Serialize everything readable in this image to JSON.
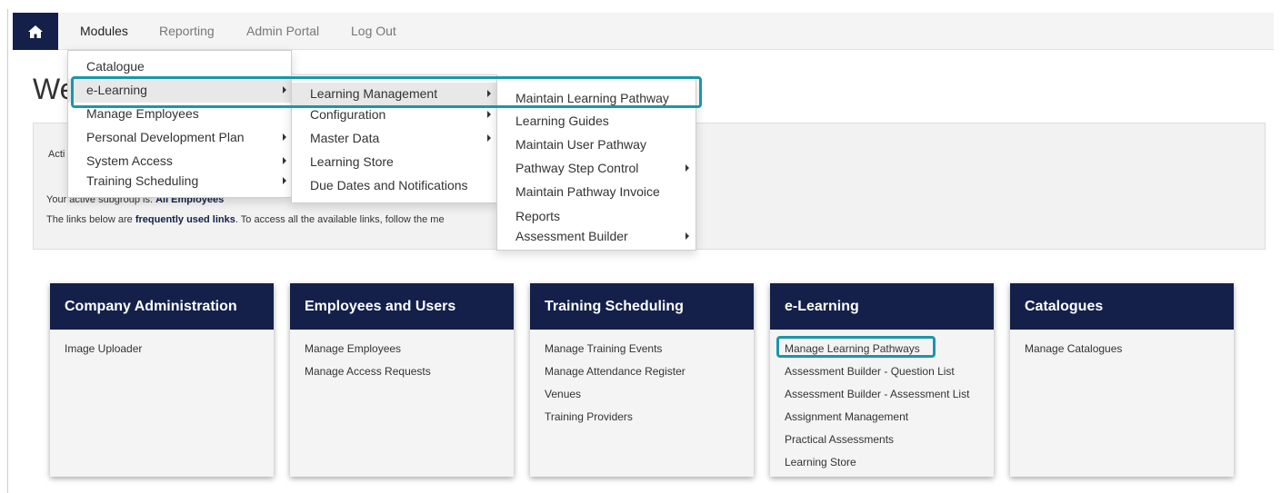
{
  "navbar": {
    "home_icon": "home-icon",
    "items": [
      "Modules",
      "Reporting",
      "Admin Portal",
      "Log Out"
    ]
  },
  "page": {
    "welcome_partial": "We",
    "info_active_partial": "Acti",
    "info_subgroup_prefix": "Your active subgroup is:",
    "info_subgroup_value": "All Employees",
    "info_links_prefix": "The links below are",
    "info_links_bold": "frequently used links",
    "info_links_suffix": ". To access all the available links, follow the me"
  },
  "menus": {
    "modules": [
      "Catalogue",
      "e-Learning",
      "Manage Employees",
      "Personal Development Plan",
      "System Access",
      "Training Scheduling"
    ],
    "elearning": [
      "Learning Management",
      "Configuration",
      "Master Data",
      "Learning Store",
      "Due Dates and Notifications"
    ],
    "learning_management": [
      "Maintain Learning Pathway",
      "Learning Guides",
      "Maintain User Pathway",
      "Pathway Step Control",
      "Maintain Pathway Invoice",
      "Reports",
      "Assessment Builder"
    ]
  },
  "cards": [
    {
      "title": "Company Administration",
      "links": [
        "Image Uploader"
      ]
    },
    {
      "title": "Employees and Users",
      "links": [
        "Manage Employees",
        "Manage Access Requests"
      ]
    },
    {
      "title": "Training Scheduling",
      "links": [
        "Manage Training Events",
        "Manage Attendance Register",
        "Venues",
        "Training Providers"
      ]
    },
    {
      "title": "e-Learning",
      "links": [
        "Manage Learning Pathways",
        "Assessment Builder - Question List",
        "Assessment Builder - Assessment List",
        "Assignment Management",
        "Practical Assessments",
        "Learning Store"
      ]
    },
    {
      "title": "Catalogues",
      "links": [
        "Manage Catalogues"
      ]
    }
  ],
  "colors": {
    "navy": "#14204a",
    "highlight": "#1a97a8"
  }
}
